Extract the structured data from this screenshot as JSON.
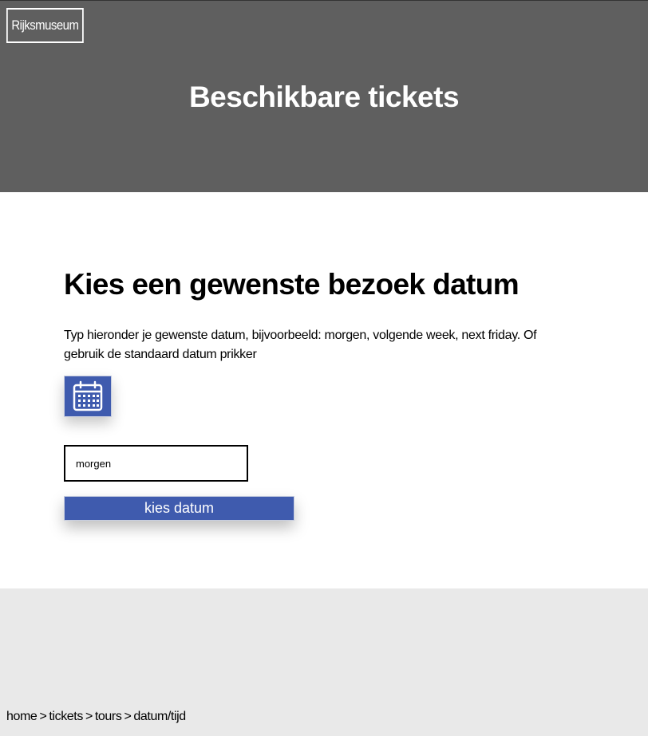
{
  "header": {
    "logo": "Rijksmuseum",
    "title": "Beschikbare tickets"
  },
  "main": {
    "heading": "Kies een gewenste bezoek datum",
    "description": "Typ hieronder je gewenste datum, bijvoorbeeld: morgen, volgende week, next friday. Of gebruik de standaard datum prikker",
    "calendar_icon": "calendar-icon",
    "date_input": {
      "value": "morgen"
    },
    "submit_label": "kies datum"
  },
  "breadcrumb": {
    "items": [
      "home",
      "tickets",
      "tours",
      "datum/tijd"
    ],
    "separator": ">"
  },
  "colors": {
    "hero_bg": "#5f5f5f",
    "accent": "#3f5bae",
    "footer_bg": "#e9e9e9"
  }
}
